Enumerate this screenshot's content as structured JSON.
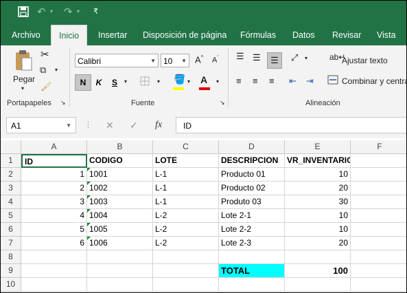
{
  "tabs": [
    "Archivo",
    "Inicio",
    "Insertar",
    "Disposición de página",
    "Fórmulas",
    "Datos",
    "Revisar",
    "Vista"
  ],
  "ribbon": {
    "paste": "Pegar",
    "group_clipboard": "Portapapeles",
    "font_name": "Calibri",
    "font_size": "10",
    "bold": "N",
    "italic": "K",
    "underline": "S",
    "group_font": "Fuente",
    "wrap_text": "Ajustar texto",
    "merge": "Combinar y centrar",
    "group_alignment": "Alineación"
  },
  "formula_bar": {
    "name_box": "A1",
    "fx": "fx",
    "value": "ID"
  },
  "columns": [
    "A",
    "B",
    "C",
    "D",
    "E",
    "F"
  ],
  "rows": [
    "1",
    "2",
    "3",
    "4",
    "5",
    "6",
    "7",
    "8",
    "9",
    "10"
  ],
  "cells": {
    "A1": "ID",
    "B1": "CODIGO",
    "C1": "LOTE",
    "D1": "DESCRIPCION",
    "E1": "VR_INVENTARIO",
    "A2": "1",
    "B2": "1001",
    "C2": "L-1",
    "D2": "Producto 01",
    "E2": "10",
    "A3": "2",
    "B3": "1002",
    "C3": "L-1",
    "D3": "Producto 02",
    "E3": "20",
    "A4": "3",
    "B4": "1003",
    "C4": "L-1",
    "D4": "Produto 03",
    "E4": "30",
    "A5": "4",
    "B5": "1004",
    "C5": "L-2",
    "D5": "Lote 2-1",
    "E5": "10",
    "A6": "5",
    "B6": "1005",
    "C6": "L-2",
    "D6": "Lote 2-2",
    "E6": "10",
    "A7": "6",
    "B7": "1006",
    "C7": "L-2",
    "D7": "Lote 2-3",
    "E7": "20",
    "D9": "TOTAL",
    "E9": "100"
  },
  "colors": {
    "brand": "#217346",
    "total_fill": "#00ffff"
  }
}
